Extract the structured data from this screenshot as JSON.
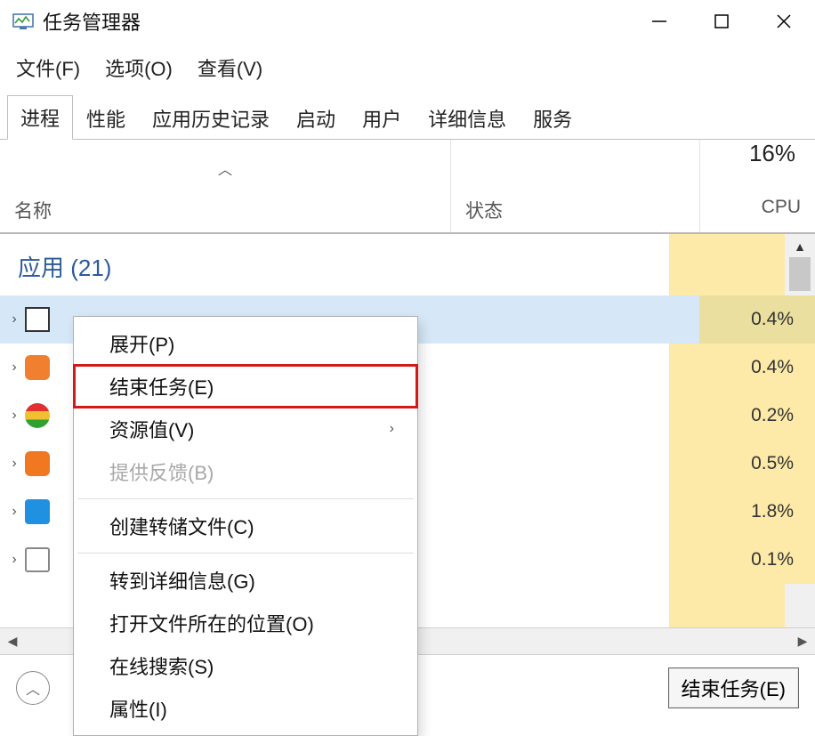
{
  "window": {
    "title": "任务管理器"
  },
  "menus": {
    "file": "文件(F)",
    "options": "选项(O)",
    "view": "查看(V)"
  },
  "tabs": {
    "processes": "进程",
    "performance": "性能",
    "history": "应用历史记录",
    "startup": "启动",
    "users": "用户",
    "details": "详细信息",
    "services": "服务"
  },
  "columns": {
    "name": "名称",
    "status": "状态",
    "cpu_label": "CPU",
    "cpu_total": "16%"
  },
  "group": {
    "apps_label": "应用 (21)"
  },
  "rows": [
    {
      "cpu": "0.4%"
    },
    {
      "cpu": "0.4%"
    },
    {
      "cpu": "0.2%"
    },
    {
      "cpu": "0.5%"
    },
    {
      "cpu": "1.8%"
    },
    {
      "cpu": "0.1%"
    }
  ],
  "context_menu": {
    "expand": "展开(P)",
    "end_task": "结束任务(E)",
    "resource_values": "资源值(V)",
    "feedback": "提供反馈(B)",
    "create_dump": "创建转储文件(C)",
    "go_details": "转到详细信息(G)",
    "open_location": "打开文件所在的位置(O)",
    "search_online": "在线搜索(S)",
    "properties": "属性(I)"
  },
  "footer": {
    "end_task_btn": "结束任务(E)"
  }
}
